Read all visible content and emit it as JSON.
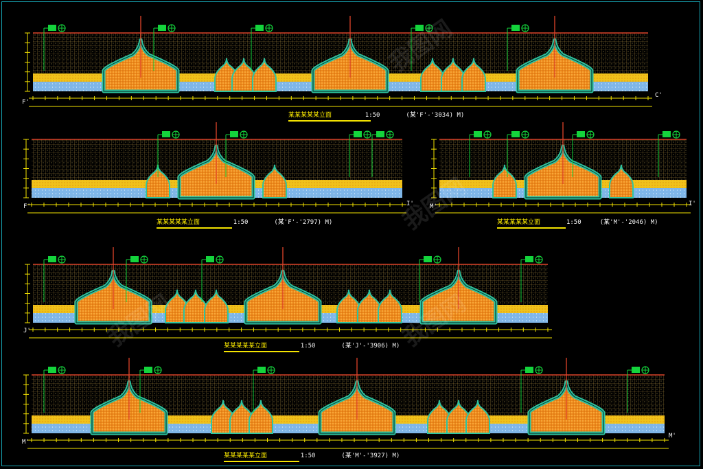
{
  "elevations": [
    {
      "title": "某某某某某立面",
      "scale": "1:50",
      "note": "(某'F'-'3034) M)",
      "left_axis": "F'",
      "right_axis": "C'"
    },
    {
      "title": "某某某某某立面",
      "scale": "1:50",
      "note": "(某'F'-'2797) M)",
      "left_axis": "F'",
      "right_axis": "I'"
    },
    {
      "title": "某某某某某立面",
      "scale": "1:50",
      "note": "(某'M'-'2046) M)",
      "left_axis": "M'",
      "right_axis": "I'"
    },
    {
      "title": "某某某某某立面",
      "scale": "1:50",
      "note": "(某'J'-'3906) M)",
      "left_axis": "J'",
      "right_axis": ""
    },
    {
      "title": "某某某某某立面",
      "scale": "1:50",
      "note": "(某'M'-'3927) M)",
      "left_axis": "M'",
      "right_axis": "M'"
    }
  ],
  "colors": {
    "background": "#000000",
    "frame": "#17a7b5",
    "grid": "#c9a24a",
    "roof_line": "#e0452a",
    "mosaic_orange": "#ef8a1a",
    "arch_outline": "#2ec4a0",
    "ground_band": "#f0c21a",
    "water_band": "#7fb6e8",
    "tag_green": "#14d43c",
    "dimension_line": "#f5e400"
  }
}
